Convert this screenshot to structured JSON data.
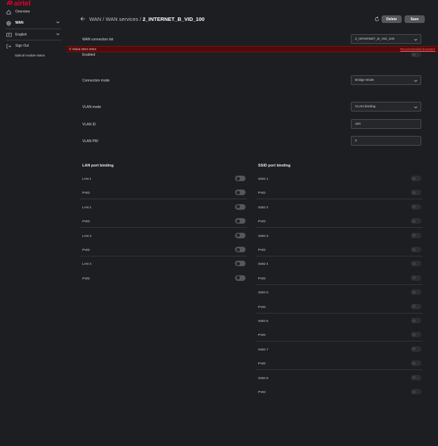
{
  "brand": {
    "name": "airtel",
    "color": "#e4002b"
  },
  "sidebar": {
    "items": [
      {
        "label": "Overview",
        "icon": "home-icon"
      },
      {
        "label": "WAN",
        "icon": "globe-icon",
        "expandable": true
      },
      {
        "label": "English",
        "icon": "language-icon",
        "expandable": true
      },
      {
        "label": "Sign Out",
        "icon": "sign-out-icon"
      }
    ],
    "sub_item": "Optical module status"
  },
  "header": {
    "breadcrumb_prefix": "WAN / WAN services / ",
    "title": "2_INTERNET_B_VID_100",
    "delete_label": "Delete",
    "save_label": "Save"
  },
  "banner": {
    "copyright": "© Nokia 2021-2024",
    "link": "Recommended browsers"
  },
  "form": {
    "wan_list_label": "WAN connection list",
    "wan_list_value": "2_INTERNET_B_VID_100",
    "enabled_label": "Enabled",
    "connection_mode_label": "Connection mode",
    "connection_mode_value": "Bridge Mode",
    "vlan_mode_label": "VLAN mode",
    "vlan_mode_value": "VLAN binding",
    "vlan_id_label": "VLAN ID",
    "vlan_id_value": "100",
    "vlan_pri_label": "VLAN PRI",
    "vlan_pri_value": "0"
  },
  "lan_binding": {
    "title": "LAN port binding",
    "rows": [
      {
        "label": "LAN 1",
        "on": true
      },
      {
        "label": "PVID",
        "on": true
      },
      {
        "label": "LAN 2",
        "on": true
      },
      {
        "label": "PVID",
        "on": true
      },
      {
        "label": "LAN 3",
        "on": true
      },
      {
        "label": "PVID",
        "on": true
      },
      {
        "label": "LAN 4",
        "on": true
      },
      {
        "label": "PVID",
        "on": true
      }
    ]
  },
  "ssid_binding": {
    "title": "SSID port binding",
    "rows": [
      {
        "label": "SSID 1",
        "on": false
      },
      {
        "label": "PVID",
        "on": false
      },
      {
        "label": "SSID 2",
        "on": false
      },
      {
        "label": "PVID",
        "on": false
      },
      {
        "label": "SSID 3",
        "on": false
      },
      {
        "label": "PVID",
        "on": false
      },
      {
        "label": "SSID 4",
        "on": false
      },
      {
        "label": "PVID",
        "on": false
      },
      {
        "label": "SSID 5",
        "on": false
      },
      {
        "label": "PVID",
        "on": false
      },
      {
        "label": "SSID 6",
        "on": false
      },
      {
        "label": "PVID",
        "on": false
      },
      {
        "label": "SSID 7",
        "on": false
      },
      {
        "label": "PVID",
        "on": false
      },
      {
        "label": "SSID 8",
        "on": false
      },
      {
        "label": "PVID",
        "on": false
      }
    ]
  }
}
